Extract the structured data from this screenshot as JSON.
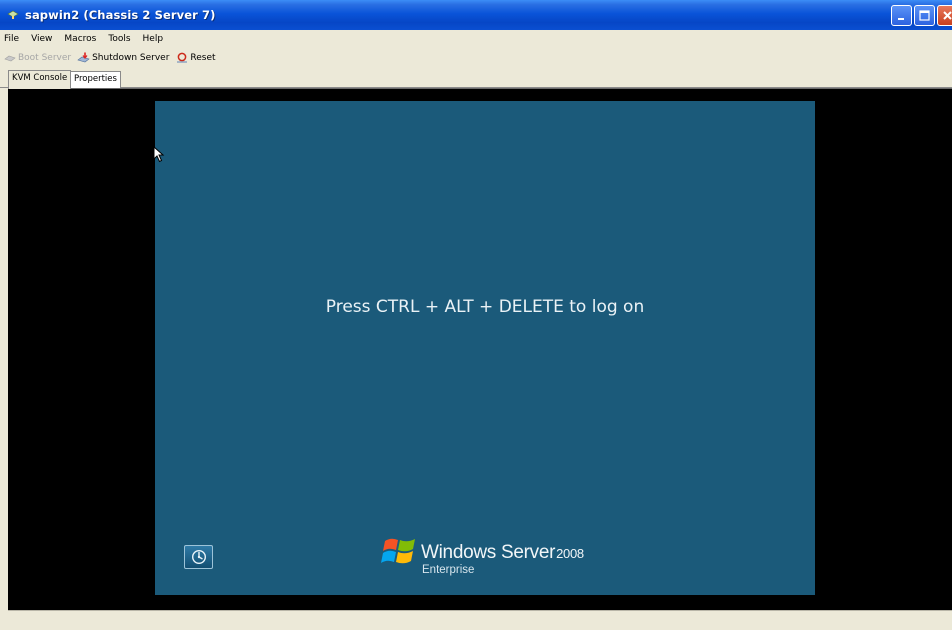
{
  "window": {
    "title": "sapwin2 (Chassis 2 Server 7)"
  },
  "menu": {
    "items": [
      "File",
      "View",
      "Macros",
      "Tools",
      "Help"
    ]
  },
  "toolbar": {
    "boot_label": "Boot Server",
    "shutdown_label": "Shutdown Server",
    "reset_label": "Reset"
  },
  "tabs": {
    "kvm_label": "KVM Console",
    "properties_label": "Properties"
  },
  "console": {
    "logon_message": "Press CTRL + ALT + DELETE to log on",
    "brand_name": "Windows Server",
    "brand_year": "2008",
    "brand_edition": "Enterprise",
    "screen_color": "#1b5a7a"
  },
  "icons": {
    "title": "server-icon",
    "boot": "power-on-icon",
    "shutdown": "shutdown-icon",
    "reset": "reset-icon",
    "accessibility": "ease-of-access-icon"
  }
}
